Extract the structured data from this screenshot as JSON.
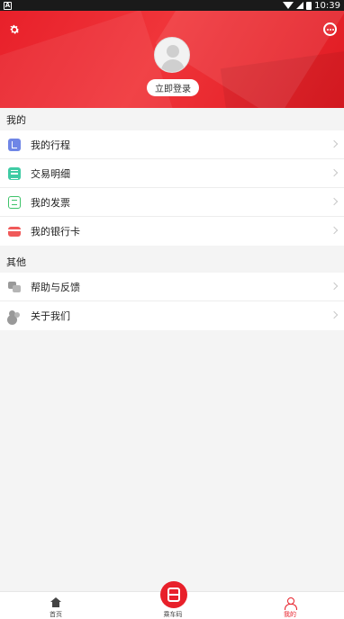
{
  "status_bar": {
    "notification_icon_letter": "A",
    "time": "10:39",
    "icons": [
      "wifi-icon",
      "signal-icon",
      "battery-icon"
    ]
  },
  "header": {
    "settings_icon": "gear-icon",
    "more_icon": "more-dots-icon",
    "avatar_icon": "default-avatar",
    "login_label": "立即登录",
    "accent_color": "#e8202a"
  },
  "sections": {
    "mine": {
      "title": "我的",
      "items": [
        {
          "label": "我的行程",
          "icon": "trip-icon",
          "color": "#6f86e6"
        },
        {
          "label": "交易明细",
          "icon": "transaction-detail-icon",
          "color": "#3fcba4"
        },
        {
          "label": "我的发票",
          "icon": "invoice-icon",
          "color": "#3ec36a"
        },
        {
          "label": "我的银行卡",
          "icon": "bank-card-icon",
          "color": "#f05a5a"
        }
      ]
    },
    "other": {
      "title": "其他",
      "items": [
        {
          "label": "帮助与反馈",
          "icon": "help-feedback-icon",
          "color": "#999999"
        },
        {
          "label": "关于我们",
          "icon": "about-us-icon",
          "color": "#999999"
        }
      ]
    }
  },
  "bottom_nav": {
    "items": [
      {
        "label": "首页",
        "icon": "home-icon",
        "active": false
      },
      {
        "label": "乘车码",
        "icon": "bus-icon",
        "active": false
      },
      {
        "label": "我的",
        "icon": "person-icon",
        "active": true
      }
    ]
  }
}
